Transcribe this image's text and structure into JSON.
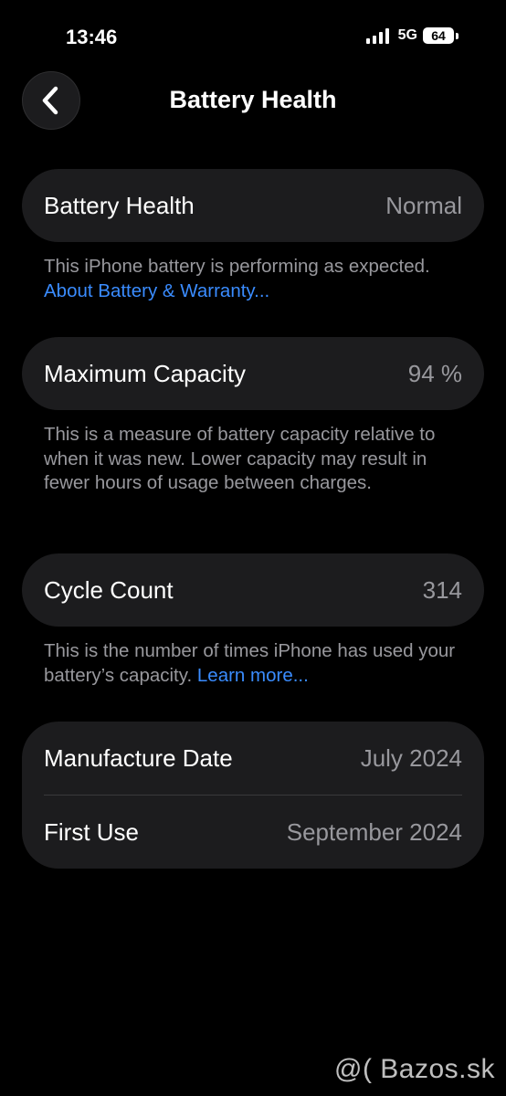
{
  "status_bar": {
    "time": "13:46",
    "network": "5G",
    "battery": "64"
  },
  "nav": {
    "title": "Battery Health",
    "back_icon": "chevron-left-icon"
  },
  "health": {
    "label": "Battery Health",
    "value": "Normal",
    "note": "This iPhone battery is performing as expected.",
    "link": "About Battery & Warranty..."
  },
  "capacity": {
    "label": "Maximum Capacity",
    "value": "94 %",
    "note": "This is a measure of battery capacity relative to when it was new. Lower capacity may result in fewer hours of usage between charges."
  },
  "cycles": {
    "label": "Cycle Count",
    "value": "314",
    "note": "This is the number of times iPhone has used your battery’s capacity.",
    "link": "Learn more..."
  },
  "dates": {
    "manufacture_label": "Manufacture Date",
    "manufacture_value": "July 2024",
    "first_use_label": "First Use",
    "first_use_value": "September 2024"
  },
  "watermark": "@( Bazos.sk",
  "colors": {
    "background": "#000000",
    "card": "#1c1c1e",
    "secondary_text": "#98989d",
    "link": "#3a8cff"
  }
}
